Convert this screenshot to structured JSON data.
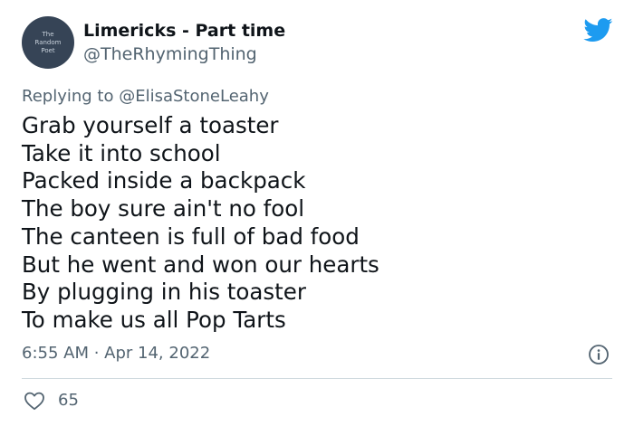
{
  "author": {
    "avatar_text": [
      "The",
      "Random",
      "Poet"
    ],
    "display_name": "Limericks - Part time",
    "handle": "@TheRhymingThing"
  },
  "reply": {
    "prefix": "Replying to",
    "mention": "@ElisaStoneLeahy"
  },
  "tweet": {
    "lines": [
      "Grab yourself a toaster",
      "Take it into school",
      "Packed inside a backpack",
      "The boy sure ain't no fool",
      "The canteen is full of bad food",
      "But he went and won our hearts",
      "By plugging in his toaster",
      "To make us all Pop Tarts"
    ],
    "timestamp": "6:55 AM · Apr 14, 2022"
  },
  "actions": {
    "like_count": "65"
  },
  "icons": {
    "brand": "twitter-bird-icon",
    "info": "info-icon",
    "like": "heart-icon"
  },
  "colors": {
    "brand_blue": "#1d9bf0",
    "text_primary": "#0f1419",
    "text_secondary": "#536471",
    "avatar_bg": "#364456",
    "divider": "#cfd9de"
  }
}
